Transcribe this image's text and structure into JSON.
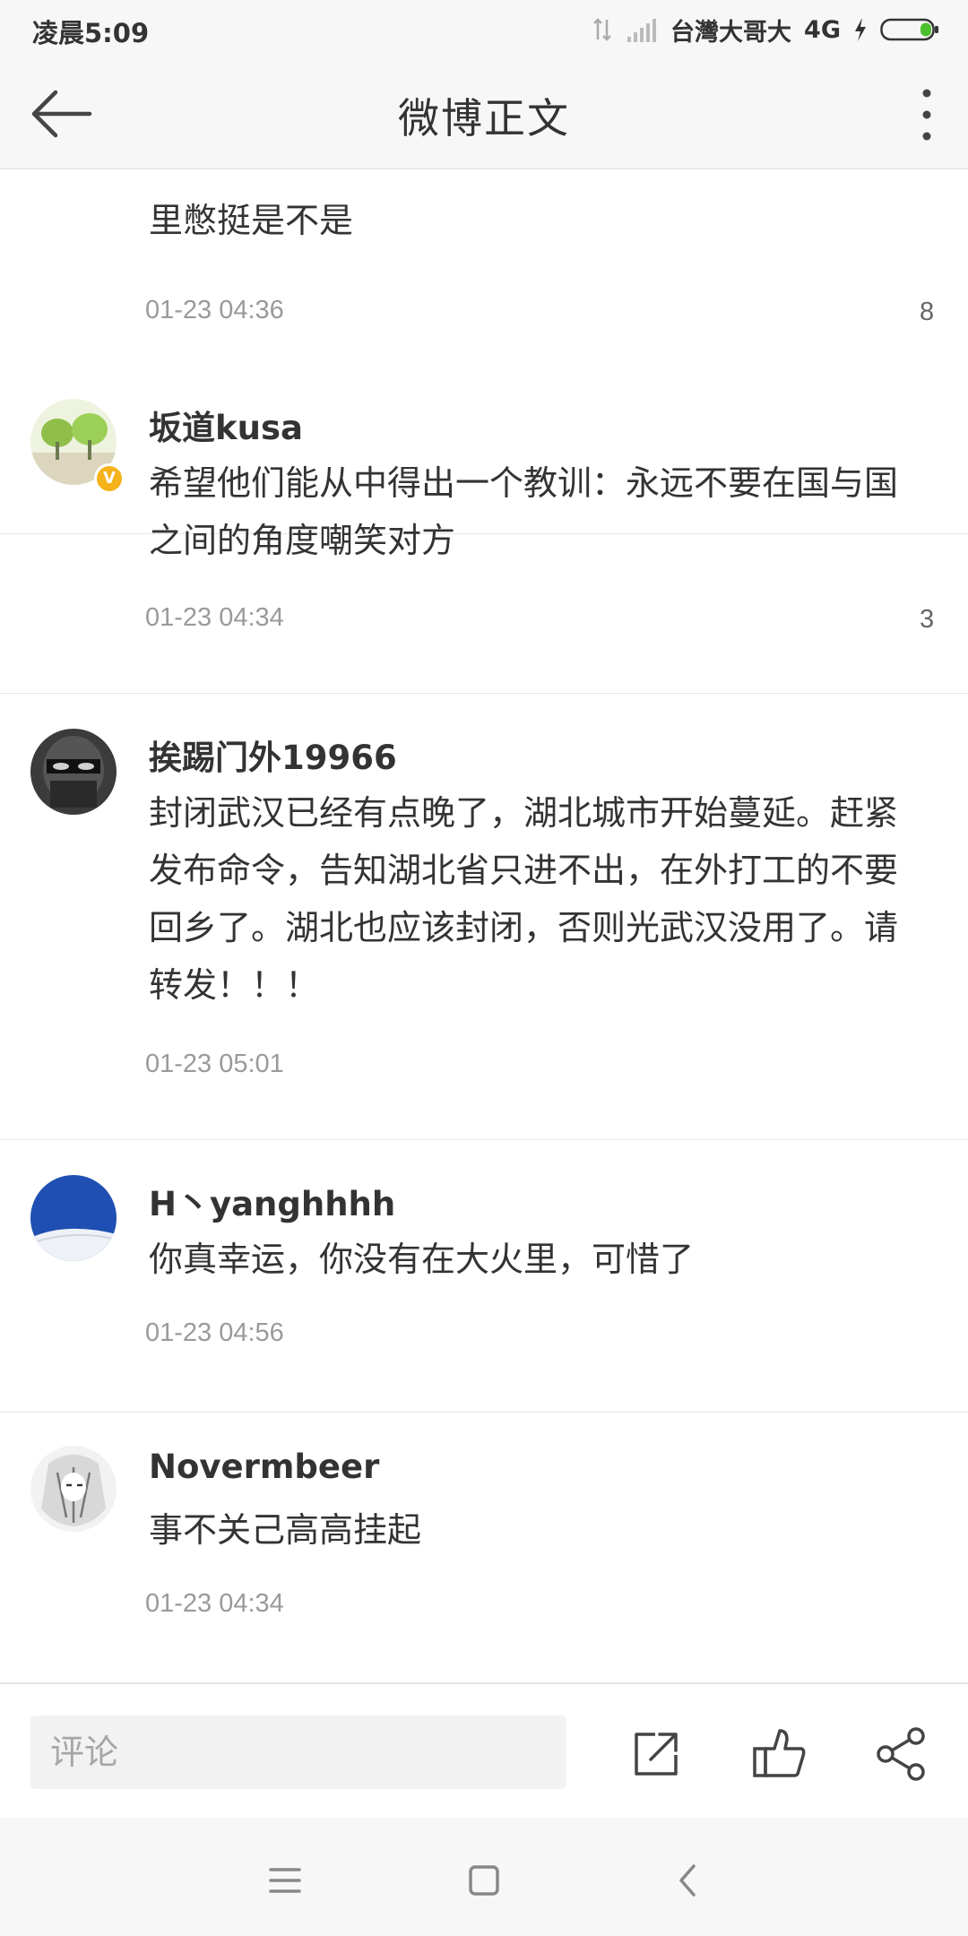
{
  "status_bar": {
    "time": "凌晨5:09",
    "carrier": "台灣大哥大",
    "network": "4G",
    "icons": [
      "data-transfer-icon",
      "signal-icon",
      "charging-bolt-icon",
      "battery-icon"
    ]
  },
  "header": {
    "title": "微博正文",
    "back_icon": "back-arrow-icon",
    "more_icon": "more-vertical-icon"
  },
  "comments": [
    {
      "username": "",
      "text": "里憋挺是不是",
      "time": "01-23 04:36",
      "likes": "8"
    },
    {
      "username": "坂道kusa",
      "verified": true,
      "text": "希望他们能从中得出一个教训：永远不要在国与国之间的角度嘲笑对方",
      "time": "01-23 04:34",
      "likes": "3"
    },
    {
      "username": "挨踢门外19966",
      "text": "封闭武汉已经有点晚了，湖北城市开始蔓延。赶紧发布命令，告知湖北省只进不出，在外打工的不要回乡了。湖北也应该封闭，否则光武汉没用了。请转发！！！",
      "time": "01-23 05:01",
      "likes": ""
    },
    {
      "username": "H丶yanghhhh",
      "text": "你真幸运，你没有在大火里，可惜了",
      "time": "01-23 04:56",
      "likes": ""
    },
    {
      "username": "Novermbeer",
      "text": "事不关己高高挂起",
      "time": "01-23 04:34",
      "likes": ""
    }
  ],
  "bottom_bar": {
    "comment_placeholder": "评论",
    "icons": [
      "repost-icon",
      "like-icon",
      "share-icon"
    ]
  },
  "nav_bar": {
    "icons": [
      "menu-icon",
      "home-icon",
      "back-icon"
    ]
  }
}
